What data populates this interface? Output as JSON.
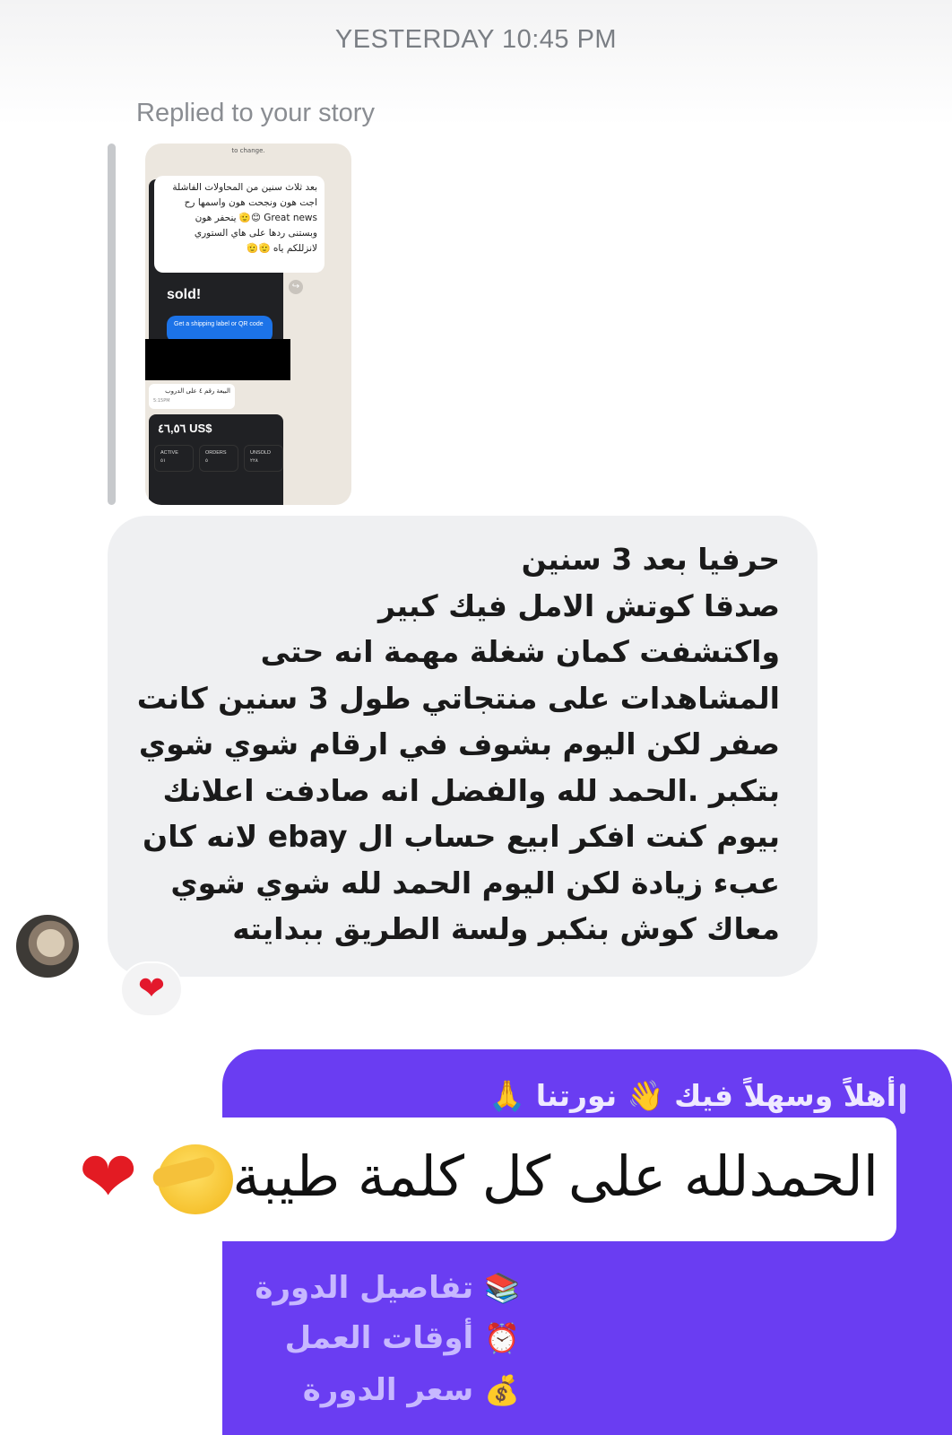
{
  "header": {
    "timestamp": "YESTERDAY 10:45 PM"
  },
  "story_reply": {
    "label": "Replied to your story",
    "thumbnail": {
      "top_caption": "to change.",
      "bubble_text": "بعد ثلاث سنين من المحاولات الفاشلة\nاجت هون ونجحت هون واسمها رح\nGreat news 😊🫡 ينحفر هون\nوبستنى ردها على هاي الستوري\nلانزللكم ياه 🫡🫡",
      "sold_text": "sold!",
      "button_text": "Get a shipping label or QR code",
      "message_text": "البيعة رقم ٤ على الدروب",
      "message_time": "5:15PM",
      "amount": "٤٦,٥٦ US$",
      "stats": [
        {
          "label": "ACTIVE",
          "value": "٥١"
        },
        {
          "label": "ORDERS",
          "value": "٥"
        },
        {
          "label": "UNSOLD",
          "value": "٢٢٨"
        }
      ]
    }
  },
  "incoming_message": {
    "text": "حرفيا بعد 3 سنين\nصدقا كوتش الامل فيك كبير\nواكتشفت كمان شغلة مهمة انه حتى\nالمشاهدات على منتجاتي طول 3 سنين كانت\nصفر لكن اليوم بشوف في ارقام شوي شوي\nبتكبر .الحمد لله والفضل انه صادفت اعلانك\nبيوم كنت افكر ابيع حساب ال ebay لانه كان\nعبء زيادة لكن اليوم الحمد لله شوي شوي\nمعاك كوش بنكبر ولسة الطريق ببدايته",
    "reaction": "❤"
  },
  "outgoing_message": {
    "welcome_line": "أهلاً وسهلاً فيك 👋 نورتنا 🙏",
    "sticker_text": "الحمدلله على كل كلمة طيبة",
    "sticker_emojis": "❤",
    "menu": [
      {
        "label": "تفاصيل الدورة",
        "icon": "📚"
      },
      {
        "label": "أوقات العمل",
        "icon": "⏰"
      },
      {
        "label": "سعر الدورة",
        "icon": "💰"
      }
    ]
  },
  "colors": {
    "outgoing_bubble": "#6a3df2",
    "incoming_bubble": "#eff0f2",
    "heart": "#e3182c"
  }
}
